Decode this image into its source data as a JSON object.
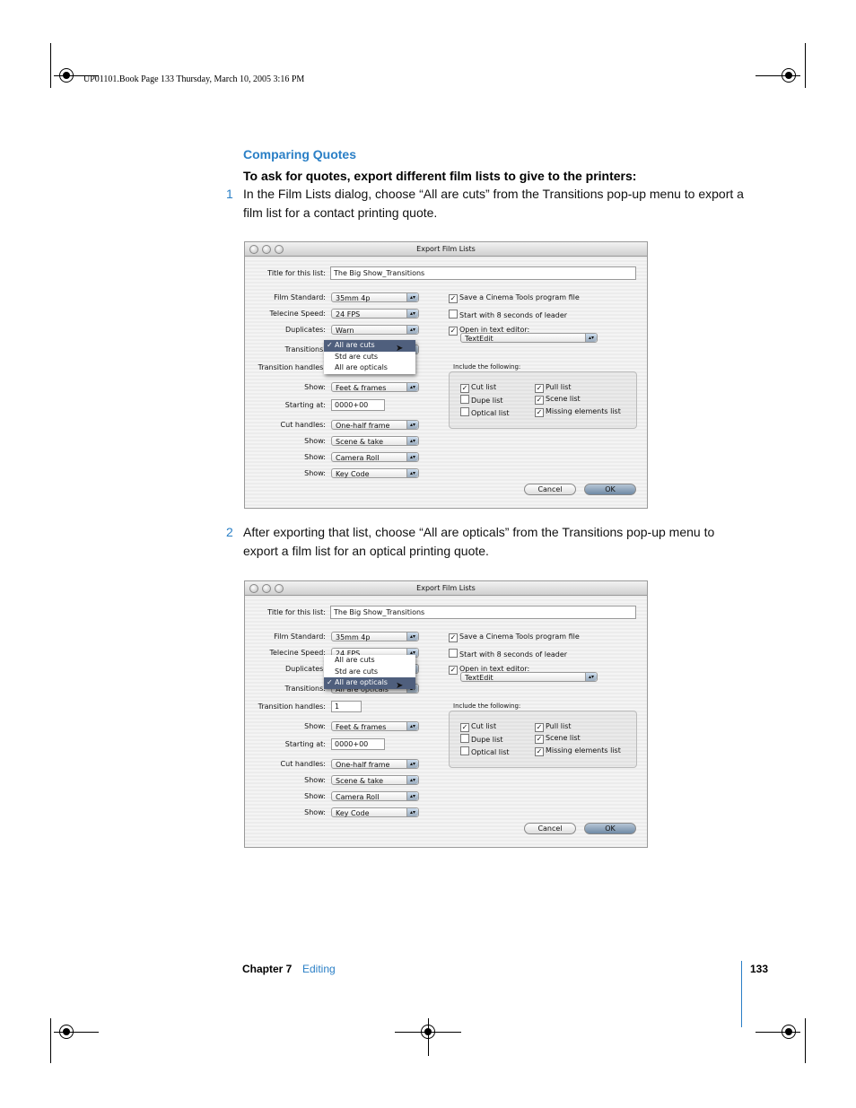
{
  "header": {
    "text": "UP01101.Book  Page 133  Thursday, March 10, 2005  3:16 PM"
  },
  "section_title": "Comparing Quotes",
  "lead": "To ask for quotes, export different film lists to give to the printers:",
  "steps": [
    {
      "num": "1",
      "text": "In the Film Lists dialog, choose “All are cuts” from the Transitions pop-up menu to export a film list for a contact printing quote."
    },
    {
      "num": "2",
      "text": "After exporting that list, choose “All are opticals” from the Transitions pop-up menu to export a film list for an optical printing quote."
    }
  ],
  "dialogs": [
    {
      "title": "Export Film Lists",
      "title_label": "Title for this list:",
      "title_value": "The Big Show_Transitions",
      "rows": [
        {
          "label": "Film Standard:",
          "value": "35mm 4p",
          "kind": "popup"
        },
        {
          "label": "Telecine Speed:",
          "value": "24 FPS",
          "kind": "popup"
        },
        {
          "label": "Duplicates:",
          "value": "Warn",
          "kind": "popup"
        },
        {
          "label": "Transitions:",
          "value": "All are cuts",
          "kind": "popup"
        },
        {
          "label": "Transition handles:",
          "value": "",
          "kind": "field"
        },
        {
          "label": "Show:",
          "value": "Feet & frames",
          "kind": "popup"
        },
        {
          "label": "Starting at:",
          "value": "0000+00",
          "kind": "field"
        },
        {
          "label": "Cut handles:",
          "value": "One-half frame",
          "kind": "popup"
        },
        {
          "label": "Show:",
          "value": "Scene & take",
          "kind": "popup"
        },
        {
          "label": "Show:",
          "value": "Camera Roll",
          "kind": "popup"
        },
        {
          "label": "Show:",
          "value": "Key Code",
          "kind": "popup"
        }
      ],
      "options": [
        {
          "label": "Save a Cinema Tools program file",
          "checked": true
        },
        {
          "label": "Start with 8 seconds of leader",
          "checked": false
        },
        {
          "label": "Open in text editor:",
          "checked": true
        }
      ],
      "editor": "TextEdit",
      "include_label": "Include the following:",
      "include": [
        {
          "label": "Cut list",
          "checked": true
        },
        {
          "label": "Dupe list",
          "checked": false
        },
        {
          "label": "Optical list",
          "checked": false
        },
        {
          "label": "Pull list",
          "checked": true
        },
        {
          "label": "Scene list",
          "checked": true
        },
        {
          "label": "Missing elements list",
          "checked": true
        }
      ],
      "menu": {
        "items": [
          "All are cuts",
          "Std are cuts",
          "All are opticals"
        ],
        "selected": 0,
        "row": 3
      },
      "cancel": "Cancel",
      "ok": "OK"
    },
    {
      "title": "Export Film Lists",
      "title_label": "Title for this list:",
      "title_value": "The Big Show_Transitions",
      "rows": [
        {
          "label": "Film Standard:",
          "value": "35mm 4p",
          "kind": "popup"
        },
        {
          "label": "Telecine Speed:",
          "value": "24 FPS",
          "kind": "popup"
        },
        {
          "label": "Duplicates:",
          "value": "",
          "kind": "popup"
        },
        {
          "label": "Transitions:",
          "value": "All are opticals",
          "kind": "popup"
        },
        {
          "label": "Transition handles:",
          "value": "1",
          "kind": "field"
        },
        {
          "label": "Show:",
          "value": "Feet & frames",
          "kind": "popup"
        },
        {
          "label": "Starting at:",
          "value": "0000+00",
          "kind": "field"
        },
        {
          "label": "Cut handles:",
          "value": "One-half frame",
          "kind": "popup"
        },
        {
          "label": "Show:",
          "value": "Scene & take",
          "kind": "popup"
        },
        {
          "label": "Show:",
          "value": "Camera Roll",
          "kind": "popup"
        },
        {
          "label": "Show:",
          "value": "Key Code",
          "kind": "popup"
        }
      ],
      "options": [
        {
          "label": "Save a Cinema Tools program file",
          "checked": true
        },
        {
          "label": "Start with 8 seconds of leader",
          "checked": false
        },
        {
          "label": "Open in text editor:",
          "checked": true
        }
      ],
      "editor": "TextEdit",
      "include_label": "Include the following:",
      "include": [
        {
          "label": "Cut list",
          "checked": true
        },
        {
          "label": "Dupe list",
          "checked": false
        },
        {
          "label": "Optical list",
          "checked": false
        },
        {
          "label": "Pull list",
          "checked": true
        },
        {
          "label": "Scene list",
          "checked": true
        },
        {
          "label": "Missing elements list",
          "checked": true
        }
      ],
      "menu": {
        "items": [
          "All are cuts",
          "Std are cuts",
          "All are opticals"
        ],
        "selected": 2,
        "row": 2
      },
      "cancel": "Cancel",
      "ok": "OK"
    }
  ],
  "footer": {
    "chapter": "Chapter 7",
    "chapter_name": "Editing",
    "page": "133"
  },
  "colors": {
    "accent": "#2a7fc6",
    "menu_selection": "#4f5f7d"
  }
}
